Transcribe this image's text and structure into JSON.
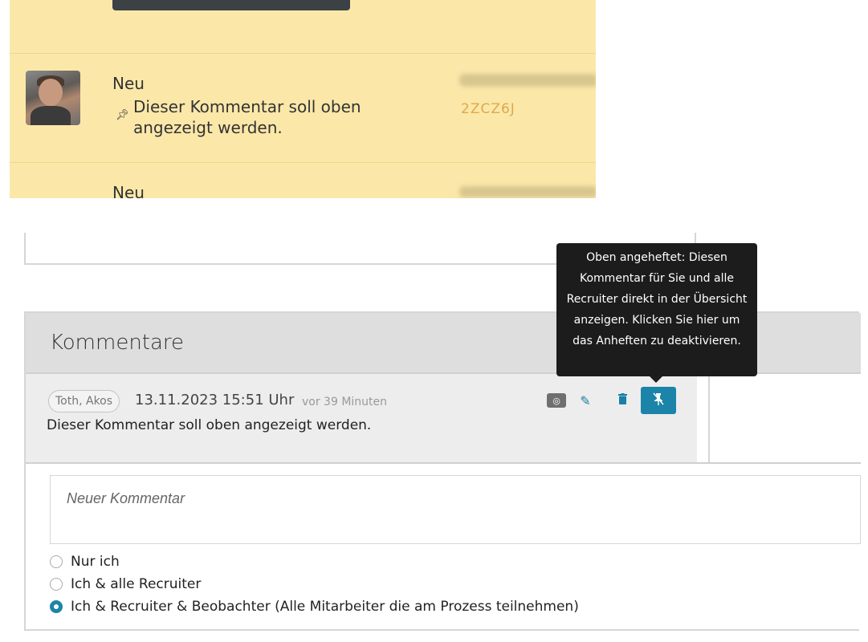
{
  "list": {
    "rows": [
      {
        "status": "Neu",
        "comment": "Dieser Kommentar soll oben angezeigt werden.",
        "code": "2ZCZ6J"
      },
      {
        "status": "Neu"
      }
    ]
  },
  "comments": {
    "title": "Kommentare",
    "item": {
      "author": "Toth, Akos",
      "date": "13.11.2023 15:51 Uhr",
      "ago": "vor 39 Minuten",
      "text": "Dieser Kommentar soll oben angezeigt werden.",
      "icons": {
        "visibility": "globe-icon",
        "edit": "pencil-icon",
        "delete": "trash-icon",
        "unpin": "unpin-icon"
      }
    },
    "new_comment_placeholder": "Neuer Kommentar",
    "visibility_options": [
      {
        "label": "Nur ich",
        "selected": false
      },
      {
        "label": "Ich & alle Recruiter",
        "selected": false
      },
      {
        "label": "Ich & Recruiter & Beobachter (Alle Mitarbeiter die am Prozess teilnehmen)",
        "selected": true
      }
    ]
  },
  "tooltip": {
    "text": "Oben angeheftet: Diesen Kommentar für Sie und alle Recruiter direkt in der Übersicht anzeigen. Klicken Sie hier um das Anheften zu deaktivieren."
  },
  "colors": {
    "accent": "#1b84a8",
    "highlight_row": "#fbe8a9"
  }
}
